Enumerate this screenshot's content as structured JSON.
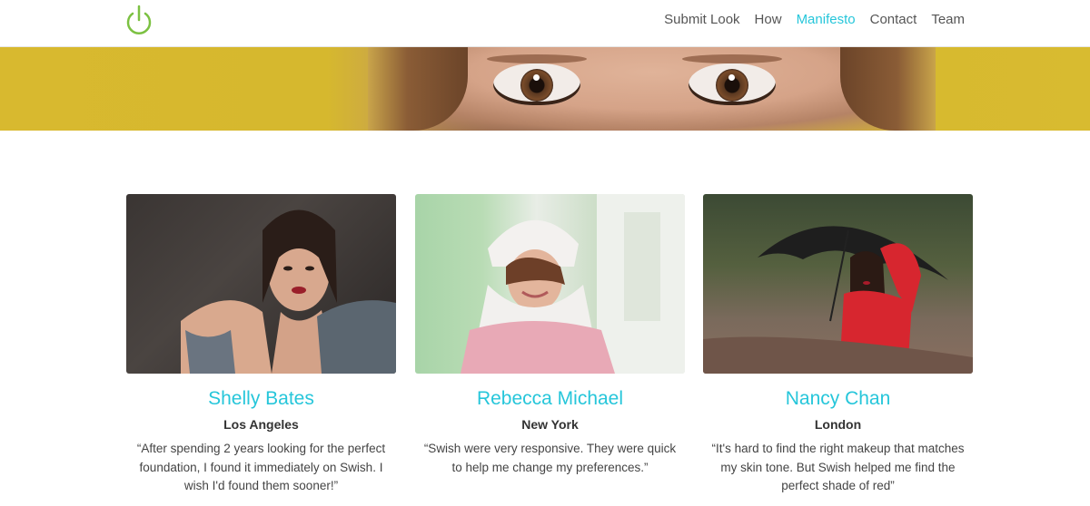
{
  "brand": {
    "logo_icon": "power-icon",
    "accent": "#7cc142"
  },
  "nav": {
    "items": [
      {
        "label": "Submit Look",
        "active": false
      },
      {
        "label": "How",
        "active": false
      },
      {
        "label": "Manifesto",
        "active": true
      },
      {
        "label": "Contact",
        "active": false
      },
      {
        "label": "Team",
        "active": false
      }
    ],
    "active_color": "#26c6da"
  },
  "testimonials": [
    {
      "name": "Shelly Bates",
      "city": "Los Angeles",
      "quote": "“After spending 2 years looking for the perfect foundation, I found it immediately on Swish. I wish I'd found them sooner!”"
    },
    {
      "name": "Rebecca Michael",
      "city": "New York",
      "quote": "“Swish were very responsive. They were quick to help me change my preferences.”"
    },
    {
      "name": "Nancy Chan",
      "city": "London",
      "quote": "“It's hard to find the right makeup that matches my skin tone. But Swish helped me find the perfect shade of red”"
    }
  ]
}
